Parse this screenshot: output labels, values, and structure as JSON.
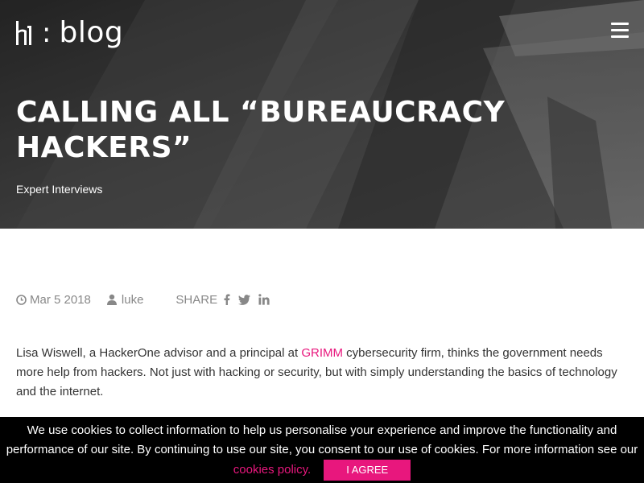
{
  "header": {
    "logo_text": "blog",
    "logo_separator": ":",
    "logo_mark": "h1",
    "menu_icon": "hamburger-icon"
  },
  "hero": {
    "title": "CALLING ALL “BUREAUCRACY HACKERS”",
    "category": "Expert Interviews"
  },
  "meta": {
    "date": "Mar 5 2018",
    "date_icon": "clock-icon",
    "author": "luke",
    "author_icon": "user-icon",
    "share_label": "SHARE",
    "social_icons": [
      "facebook-icon",
      "twitter-icon",
      "linkedin-icon"
    ]
  },
  "article": {
    "p1_before": "Lisa Wiswell, a HackerOne advisor and a principal at ",
    "p1_link": "GRIMM",
    "p1_after": " cybersecurity firm, thinks the government needs more help from hackers. Not just with hacking or security, but with simply understanding the basics of technology and the internet."
  },
  "cookie_bar": {
    "text": "We use cookies to collect information to help us personalise your experience and improve the functionality and performance of our site. By continuing to use our site, you consent to our use of cookies. For more information see our ",
    "link_text": "cookies policy.",
    "button_label": "I agree"
  },
  "colors": {
    "accent": "#e8177d",
    "hero_bg": "#3a3a3a",
    "meta_text": "#888888",
    "cookie_bg": "#000000"
  }
}
